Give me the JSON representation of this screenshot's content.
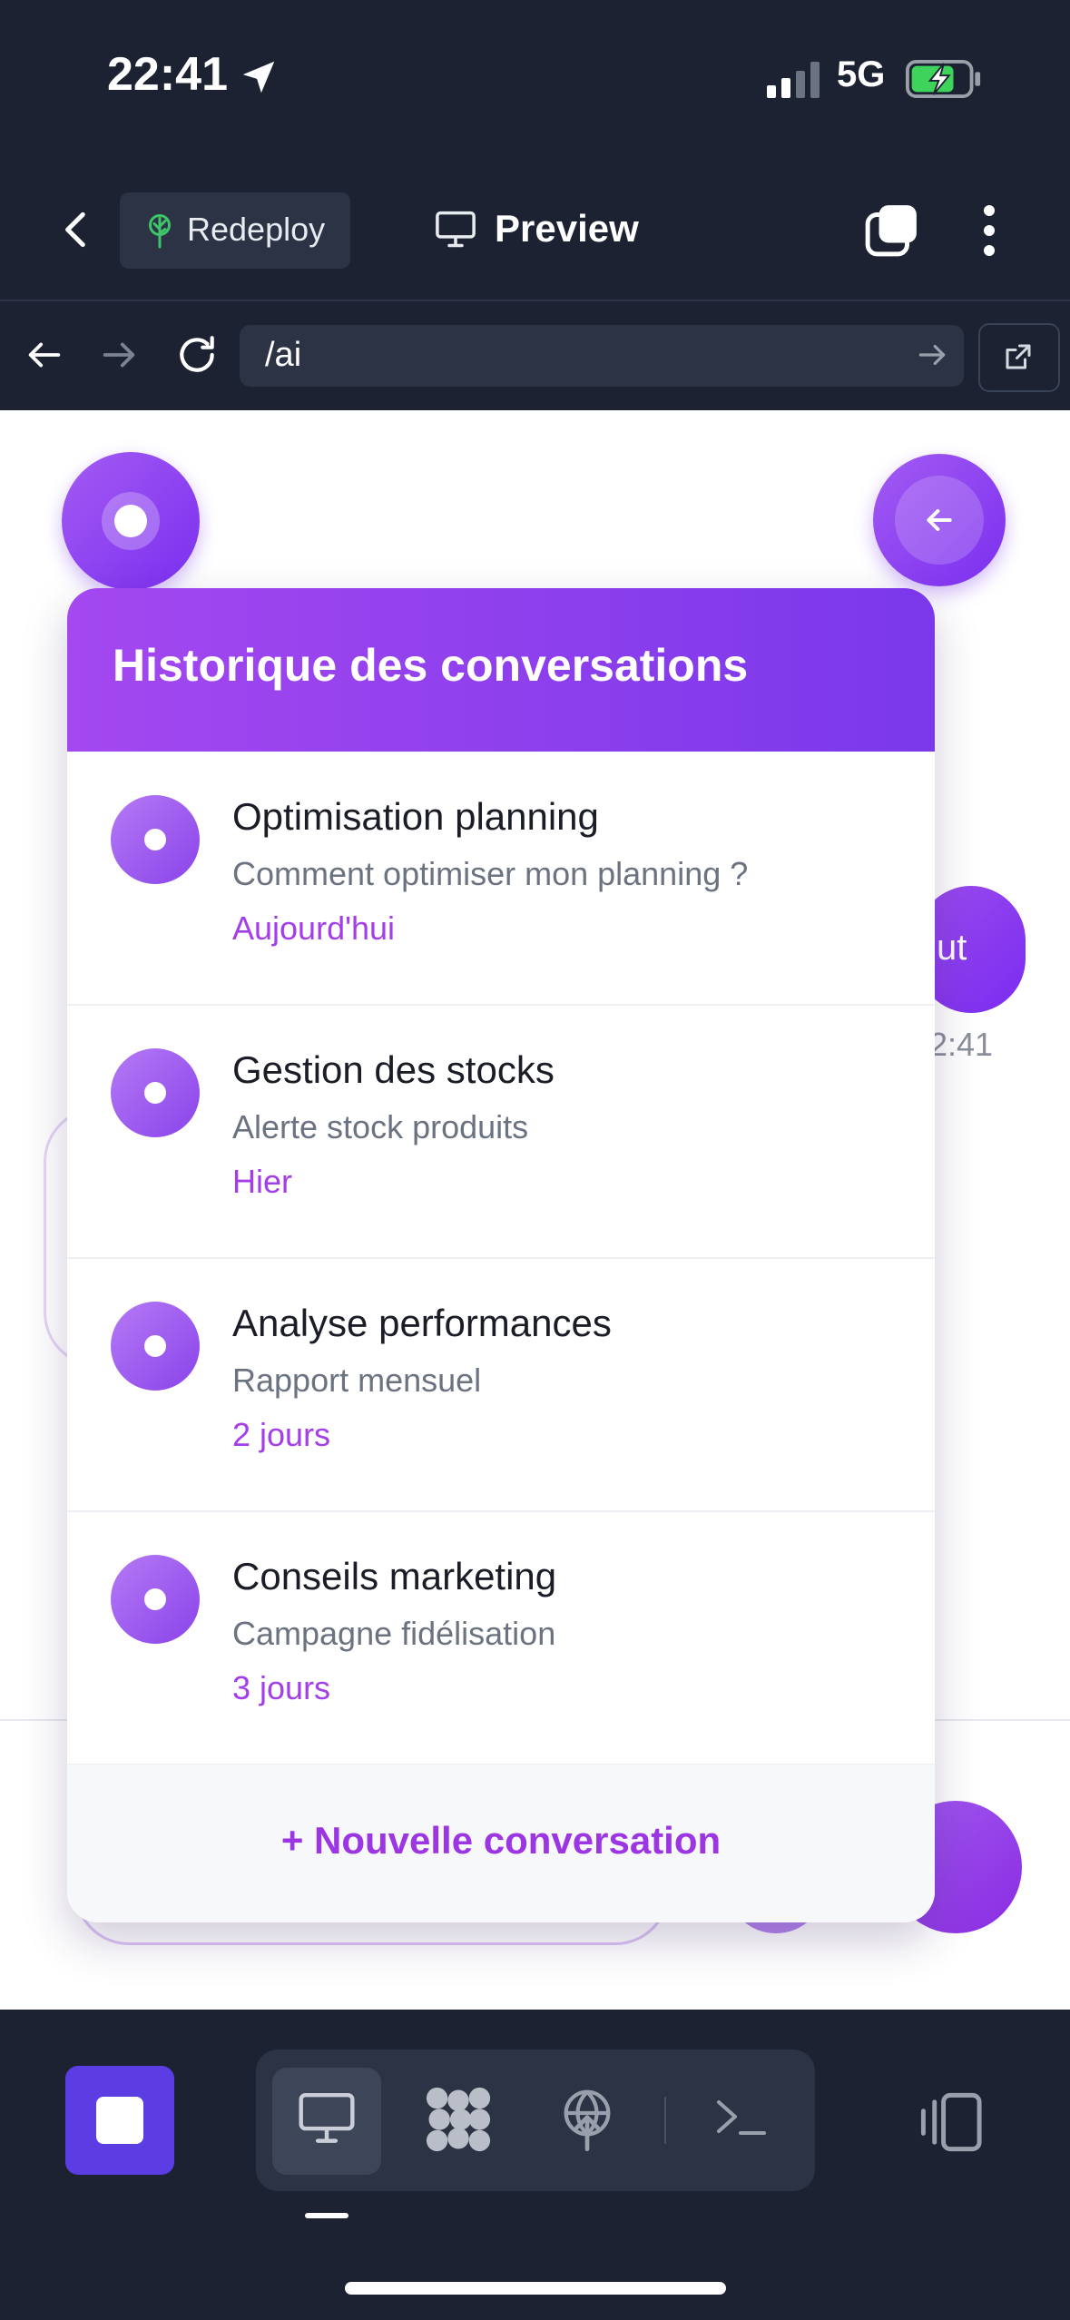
{
  "status_bar": {
    "time": "22:41",
    "network": "5G"
  },
  "toolbar": {
    "redeploy_label": "Redeploy",
    "preview_label": "Preview"
  },
  "url_bar": {
    "url": "/ai"
  },
  "background_chat": {
    "bubble_text": "ut",
    "time": "2:41"
  },
  "history": {
    "title": "Historique des conversations",
    "items": [
      {
        "title": "Optimisation planning",
        "preview": "Comment optimiser mon planning ?",
        "date": "Aujourd'hui"
      },
      {
        "title": "Gestion des stocks",
        "preview": "Alerte stock produits",
        "date": "Hier"
      },
      {
        "title": "Analyse performances",
        "preview": "Rapport mensuel",
        "date": "2 jours"
      },
      {
        "title": "Conseils marketing",
        "preview": "Campagne fidélisation",
        "date": "3 jours"
      }
    ],
    "new_conversation_label": "+ Nouvelle conversation"
  },
  "colors": {
    "accent": "#8b3ef0",
    "date": "#a33ee8",
    "dark_bg": "#1c2232",
    "stop_button": "#5b3de3"
  },
  "icons": [
    "location-arrow-icon",
    "signal-icon",
    "battery-charging-icon",
    "back-chevron-icon",
    "tree-icon",
    "monitor-icon",
    "tabs-icon",
    "more-vertical-icon",
    "arrow-left-icon",
    "arrow-right-icon",
    "reload-icon",
    "external-link-icon",
    "stop-icon",
    "apps-icon",
    "deploy-globe-icon",
    "terminal-icon",
    "device-toggle-icon"
  ]
}
